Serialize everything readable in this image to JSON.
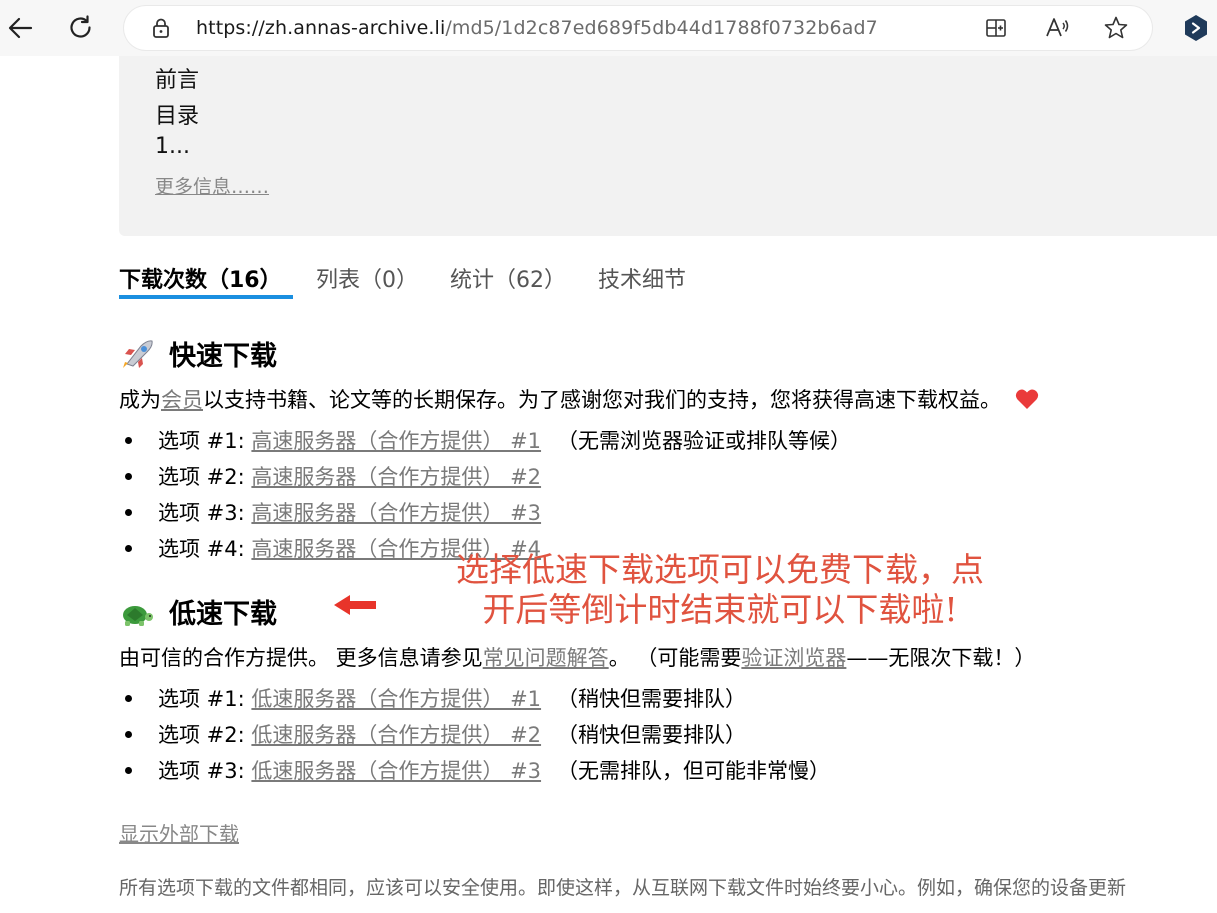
{
  "browser": {
    "url_host": "https://zh.annas-archive.li",
    "url_path": "/md5/1d2c87ed689f5db44d1788f0732b6ad7",
    "icons": [
      "back-arrow-icon",
      "refresh-icon",
      "lock-icon",
      "split-screen-icon",
      "read-aloud-icon",
      "favorite-star-icon",
      "extension-icon"
    ]
  },
  "description": {
    "lines": [
      "前言",
      "目录",
      "1..."
    ],
    "more_link": "更多信息……"
  },
  "tabs": [
    {
      "label": "下载次数（16）",
      "active": true
    },
    {
      "label": "列表（0）",
      "active": false
    },
    {
      "label": "统计（62）",
      "active": false
    },
    {
      "label": "技术细节",
      "active": false
    }
  ],
  "fast": {
    "title": "快速下载",
    "intro_prefix": "成为",
    "intro_link": "会员",
    "intro_suffix": "以支持书籍、论文等的长期保存。为了感谢您对我们的支持，您将获得高速下载权益。",
    "options": [
      {
        "label": "选项 #1:",
        "link": "高速服务器（合作方提供） #1",
        "note": "（无需浏览器验证或排队等候）"
      },
      {
        "label": "选项 #2:",
        "link": "高速服务器（合作方提供） #2",
        "note": ""
      },
      {
        "label": "选项 #3:",
        "link": "高速服务器（合作方提供） #3",
        "note": ""
      },
      {
        "label": "选项 #4:",
        "link": "高速服务器（合作方提供） #4",
        "note": ""
      }
    ]
  },
  "slow": {
    "title": "低速下载",
    "intro_prefix": "由可信的合作方提供。 更多信息请参见",
    "intro_link1": "常见问题解答",
    "intro_middle": "。 （可能需要",
    "intro_link2": "验证浏览器",
    "intro_suffix": "——无限次下载！）",
    "options": [
      {
        "label": "选项 #1:",
        "link": "低速服务器（合作方提供） #1",
        "note": "（稍快但需要排队）"
      },
      {
        "label": "选项 #2:",
        "link": "低速服务器（合作方提供） #2",
        "note": "（稍快但需要排队）"
      },
      {
        "label": "选项 #3:",
        "link": "低速服务器（合作方提供） #3",
        "note": "（无需排队，但可能非常慢）"
      }
    ]
  },
  "annotation": {
    "line1": "选择低速下载选项可以免费下载，点",
    "line2": "开后等倒计时结束就可以下载啦!",
    "color": "#e0533f"
  },
  "external_downloads_link": "显示外部下载",
  "footer_text": "所有选项下载的文件都相同，应该可以安全使用。即使这样，从互联网下载文件时始终要小心。例如，确保您的设备更新"
}
